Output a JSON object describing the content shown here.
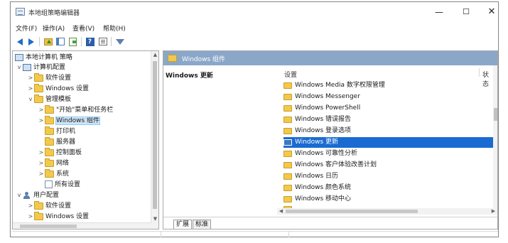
{
  "window": {
    "title": "本地组策略编辑器",
    "buttons": {
      "minimize": "—",
      "maximize": "☐",
      "close": "✕"
    }
  },
  "menu": {
    "items": [
      "文件(F)",
      "操作(A)",
      "查看(V)",
      "帮助(H)"
    ]
  },
  "toolbar": {
    "icons": [
      "back-icon",
      "forward-icon",
      "up-folder-icon",
      "show-hide-tree-icon",
      "export-list-icon",
      "help-icon",
      "view-icon",
      "filter-icon"
    ]
  },
  "tree": {
    "root": "本地计算机 策略",
    "nodes": [
      {
        "label": "计算机配置",
        "expander": "v",
        "icon": "computer-icon"
      },
      {
        "label": "软件设置",
        "expander": ">",
        "icon": "folder-icon"
      },
      {
        "label": "Windows 设置",
        "expander": ">",
        "icon": "folder-icon"
      },
      {
        "label": "管理模板",
        "expander": "v",
        "icon": "folder-icon"
      },
      {
        "label": "\"开始\"菜单和任务栏",
        "expander": ">",
        "icon": "folder-icon"
      },
      {
        "label": "Windows 组件",
        "expander": ">",
        "icon": "folder-icon"
      },
      {
        "label": "打印机",
        "expander": "",
        "icon": "folder-icon"
      },
      {
        "label": "服务器",
        "expander": "",
        "icon": "folder-icon"
      },
      {
        "label": "控制面板",
        "expander": ">",
        "icon": "folder-icon"
      },
      {
        "label": "网络",
        "expander": ">",
        "icon": "folder-icon"
      },
      {
        "label": "系统",
        "expander": ">",
        "icon": "folder-icon"
      },
      {
        "label": "所有设置",
        "expander": "",
        "icon": "settings-doc-icon"
      },
      {
        "label": "用户配置",
        "expander": "v",
        "icon": "user-icon"
      },
      {
        "label": "软件设置",
        "expander": ">",
        "icon": "folder-icon"
      },
      {
        "label": "Windows 设置",
        "expander": ">",
        "icon": "folder-icon"
      }
    ]
  },
  "right_pane": {
    "path": "Windows 组件",
    "description_title": "Windows 更新",
    "columns": {
      "setting": "设置",
      "state": "状态"
    },
    "rows": [
      "Windows Media 数字权限管理",
      "Windows Messenger",
      "Windows PowerShell",
      "Windows 错误报告",
      "Windows 登录选项",
      "Windows 更新",
      "Windows 可靠性分析",
      "Windows 客户体验改善计划",
      "Windows 日历",
      "Windows 颜色系统",
      "Windows 移动中心"
    ],
    "selected_row": "Windows 更新",
    "tabs": [
      "扩展",
      "标准"
    ]
  },
  "colors": {
    "path_bar": "#8aa7c9",
    "selection": "#1a6bd1",
    "folder": "#f2c94c"
  }
}
